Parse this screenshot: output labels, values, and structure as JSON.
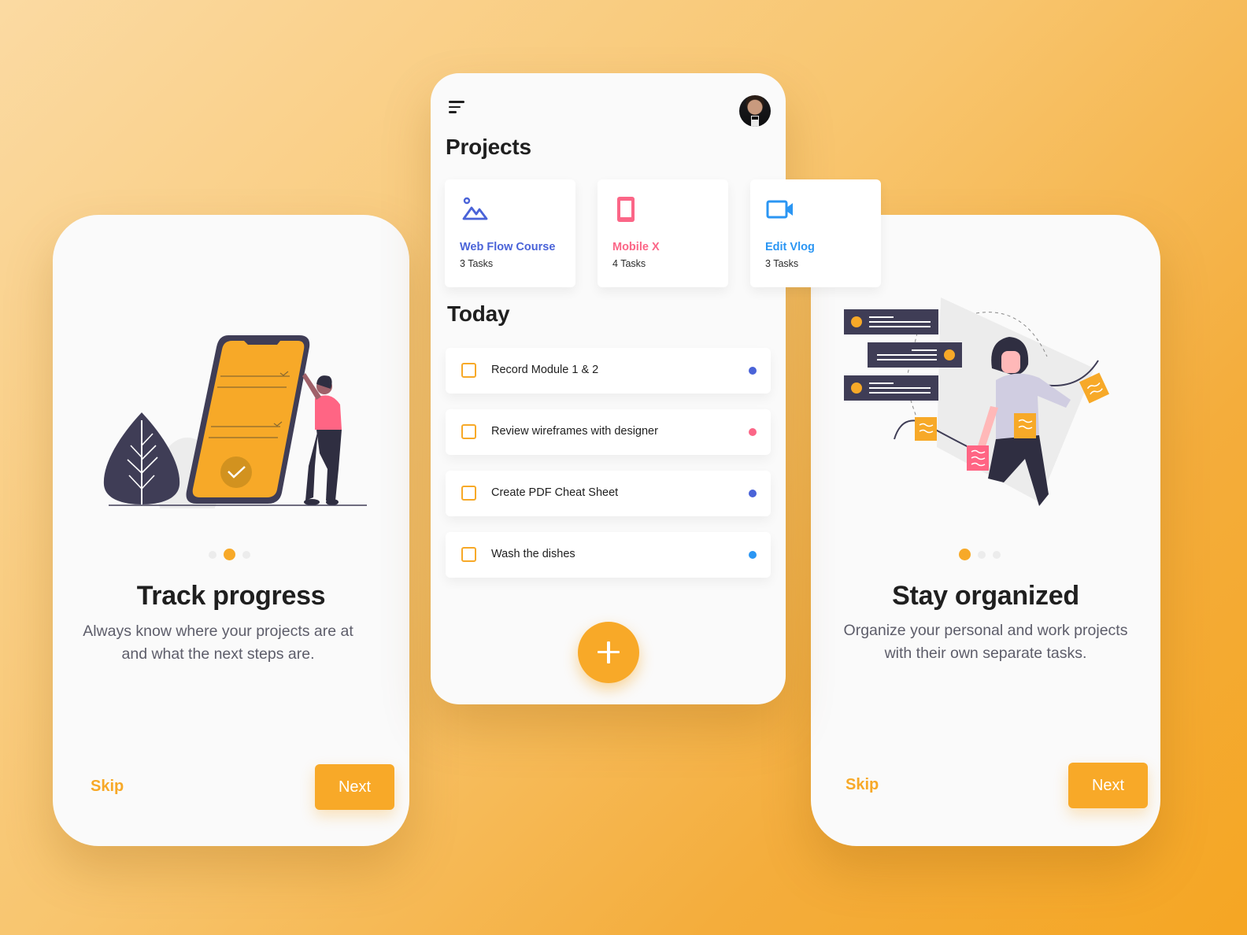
{
  "onboarding": [
    {
      "title": "Track progress",
      "description_line1": "Always know where your projects are at",
      "description_line2": "and what the next steps are.",
      "page_indicator": {
        "total": 3,
        "active_index": 1
      },
      "skip_label": "Skip",
      "next_label": "Next",
      "illustration": "phone-checklist-illustration"
    },
    {
      "title": "Stay organized",
      "description_line1": "Organize your personal and work projects",
      "description_line2": "with their own separate tasks.",
      "page_indicator": {
        "total": 3,
        "active_index": 0
      },
      "skip_label": "Skip",
      "next_label": "Next",
      "illustration": "sticky-notes-illustration"
    }
  ],
  "app": {
    "menu_icon": "menu-icon",
    "avatar": "user-avatar",
    "projects_heading": "Projects",
    "projects": [
      {
        "name": "Web Flow Course",
        "count": "3 Tasks",
        "icon": "image-icon",
        "color": "#4a63d8"
      },
      {
        "name": "Mobile X",
        "count": "4 Tasks",
        "icon": "mobile-icon",
        "color": "#fb6687"
      },
      {
        "name": "Edit Vlog",
        "count": "3 Tasks",
        "icon": "video-icon",
        "color": "#2b96f3"
      }
    ],
    "today_heading": "Today",
    "tasks": [
      {
        "label": "Record Module 1 & 2",
        "checked": false,
        "tag_color": "#4a63d8"
      },
      {
        "label": "Review wireframes with designer",
        "checked": false,
        "tag_color": "#fb6687"
      },
      {
        "label": "Create PDF Cheat Sheet",
        "checked": false,
        "tag_color": "#4a63d8"
      },
      {
        "label": "Wash the dishes",
        "checked": false,
        "tag_color": "#2b96f3"
      }
    ],
    "add_button": "plus-icon"
  },
  "colors": {
    "accent": "#f8a928",
    "text_dark": "#1f1f1f",
    "text_muted": "#5d5d6a",
    "card_bg": "#fafafa"
  }
}
